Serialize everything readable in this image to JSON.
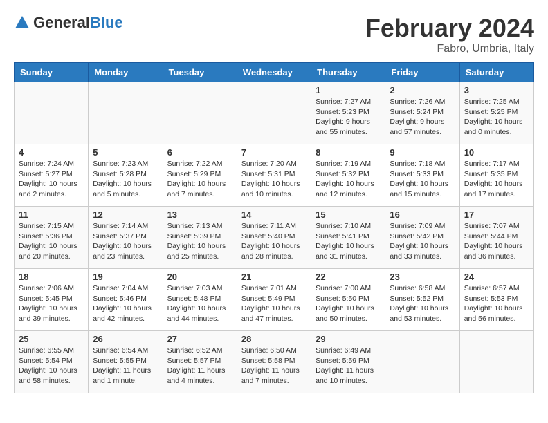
{
  "header": {
    "logo_general": "General",
    "logo_blue": "Blue",
    "main_title": "February 2024",
    "subtitle": "Fabro, Umbria, Italy"
  },
  "columns": [
    "Sunday",
    "Monday",
    "Tuesday",
    "Wednesday",
    "Thursday",
    "Friday",
    "Saturday"
  ],
  "weeks": [
    {
      "days": [
        {
          "num": "",
          "info": ""
        },
        {
          "num": "",
          "info": ""
        },
        {
          "num": "",
          "info": ""
        },
        {
          "num": "",
          "info": ""
        },
        {
          "num": "1",
          "info": "Sunrise: 7:27 AM\nSunset: 5:23 PM\nDaylight: 9 hours\nand 55 minutes."
        },
        {
          "num": "2",
          "info": "Sunrise: 7:26 AM\nSunset: 5:24 PM\nDaylight: 9 hours\nand 57 minutes."
        },
        {
          "num": "3",
          "info": "Sunrise: 7:25 AM\nSunset: 5:25 PM\nDaylight: 10 hours\nand 0 minutes."
        }
      ]
    },
    {
      "days": [
        {
          "num": "4",
          "info": "Sunrise: 7:24 AM\nSunset: 5:27 PM\nDaylight: 10 hours\nand 2 minutes."
        },
        {
          "num": "5",
          "info": "Sunrise: 7:23 AM\nSunset: 5:28 PM\nDaylight: 10 hours\nand 5 minutes."
        },
        {
          "num": "6",
          "info": "Sunrise: 7:22 AM\nSunset: 5:29 PM\nDaylight: 10 hours\nand 7 minutes."
        },
        {
          "num": "7",
          "info": "Sunrise: 7:20 AM\nSunset: 5:31 PM\nDaylight: 10 hours\nand 10 minutes."
        },
        {
          "num": "8",
          "info": "Sunrise: 7:19 AM\nSunset: 5:32 PM\nDaylight: 10 hours\nand 12 minutes."
        },
        {
          "num": "9",
          "info": "Sunrise: 7:18 AM\nSunset: 5:33 PM\nDaylight: 10 hours\nand 15 minutes."
        },
        {
          "num": "10",
          "info": "Sunrise: 7:17 AM\nSunset: 5:35 PM\nDaylight: 10 hours\nand 17 minutes."
        }
      ]
    },
    {
      "days": [
        {
          "num": "11",
          "info": "Sunrise: 7:15 AM\nSunset: 5:36 PM\nDaylight: 10 hours\nand 20 minutes."
        },
        {
          "num": "12",
          "info": "Sunrise: 7:14 AM\nSunset: 5:37 PM\nDaylight: 10 hours\nand 23 minutes."
        },
        {
          "num": "13",
          "info": "Sunrise: 7:13 AM\nSunset: 5:39 PM\nDaylight: 10 hours\nand 25 minutes."
        },
        {
          "num": "14",
          "info": "Sunrise: 7:11 AM\nSunset: 5:40 PM\nDaylight: 10 hours\nand 28 minutes."
        },
        {
          "num": "15",
          "info": "Sunrise: 7:10 AM\nSunset: 5:41 PM\nDaylight: 10 hours\nand 31 minutes."
        },
        {
          "num": "16",
          "info": "Sunrise: 7:09 AM\nSunset: 5:42 PM\nDaylight: 10 hours\nand 33 minutes."
        },
        {
          "num": "17",
          "info": "Sunrise: 7:07 AM\nSunset: 5:44 PM\nDaylight: 10 hours\nand 36 minutes."
        }
      ]
    },
    {
      "days": [
        {
          "num": "18",
          "info": "Sunrise: 7:06 AM\nSunset: 5:45 PM\nDaylight: 10 hours\nand 39 minutes."
        },
        {
          "num": "19",
          "info": "Sunrise: 7:04 AM\nSunset: 5:46 PM\nDaylight: 10 hours\nand 42 minutes."
        },
        {
          "num": "20",
          "info": "Sunrise: 7:03 AM\nSunset: 5:48 PM\nDaylight: 10 hours\nand 44 minutes."
        },
        {
          "num": "21",
          "info": "Sunrise: 7:01 AM\nSunset: 5:49 PM\nDaylight: 10 hours\nand 47 minutes."
        },
        {
          "num": "22",
          "info": "Sunrise: 7:00 AM\nSunset: 5:50 PM\nDaylight: 10 hours\nand 50 minutes."
        },
        {
          "num": "23",
          "info": "Sunrise: 6:58 AM\nSunset: 5:52 PM\nDaylight: 10 hours\nand 53 minutes."
        },
        {
          "num": "24",
          "info": "Sunrise: 6:57 AM\nSunset: 5:53 PM\nDaylight: 10 hours\nand 56 minutes."
        }
      ]
    },
    {
      "days": [
        {
          "num": "25",
          "info": "Sunrise: 6:55 AM\nSunset: 5:54 PM\nDaylight: 10 hours\nand 58 minutes."
        },
        {
          "num": "26",
          "info": "Sunrise: 6:54 AM\nSunset: 5:55 PM\nDaylight: 11 hours\nand 1 minute."
        },
        {
          "num": "27",
          "info": "Sunrise: 6:52 AM\nSunset: 5:57 PM\nDaylight: 11 hours\nand 4 minutes."
        },
        {
          "num": "28",
          "info": "Sunrise: 6:50 AM\nSunset: 5:58 PM\nDaylight: 11 hours\nand 7 minutes."
        },
        {
          "num": "29",
          "info": "Sunrise: 6:49 AM\nSunset: 5:59 PM\nDaylight: 11 hours\nand 10 minutes."
        },
        {
          "num": "",
          "info": ""
        },
        {
          "num": "",
          "info": ""
        }
      ]
    }
  ]
}
